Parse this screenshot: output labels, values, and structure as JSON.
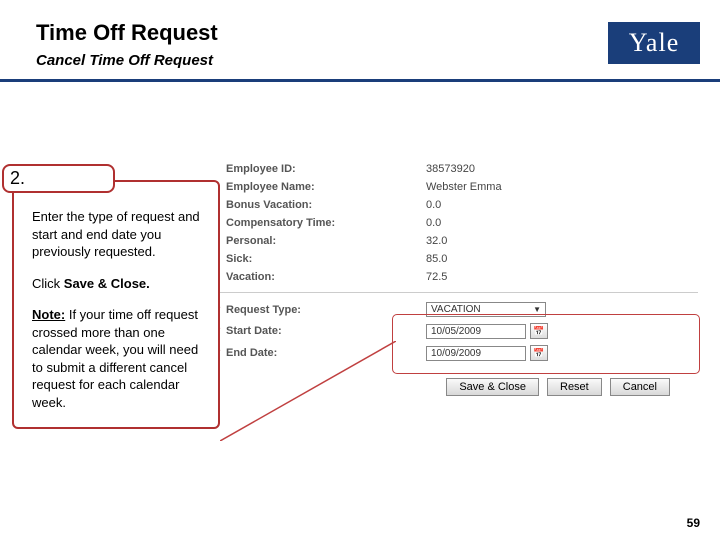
{
  "header": {
    "title": "Time Off Request",
    "subtitle": "Cancel Time Off Request",
    "logo_text": "Yale"
  },
  "step": {
    "number": "2."
  },
  "instructions": {
    "p1": "Enter the type of request and start and end date you previously requested.",
    "p2_prefix": "Click ",
    "p2_bold": "Save & Close.",
    "note_label": "Note:",
    "note_body": " If your time off request crossed more than one calendar week, you will need to submit a different cancel request for each calendar week."
  },
  "form": {
    "fields": {
      "employee_id": {
        "label": "Employee ID:",
        "value": "38573920"
      },
      "employee_name": {
        "label": "Employee Name:",
        "value": "Webster Emma"
      },
      "bonus_vacation": {
        "label": "Bonus Vacation:",
        "value": "0.0"
      },
      "compensatory_time": {
        "label": "Compensatory Time:",
        "value": "0.0"
      },
      "personal": {
        "label": "Personal:",
        "value": "32.0"
      },
      "sick": {
        "label": "Sick:",
        "value": "85.0"
      },
      "vacation": {
        "label": "Vacation:",
        "value": "72.5"
      }
    },
    "inputs": {
      "request_type": {
        "label": "Request Type:",
        "value": "VACATION"
      },
      "start_date": {
        "label": "Start Date:",
        "value": "10/05/2009"
      },
      "end_date": {
        "label": "End Date:",
        "value": "10/09/2009"
      }
    },
    "buttons": {
      "save_close": "Save & Close",
      "reset": "Reset",
      "cancel": "Cancel"
    }
  },
  "page_number": "59"
}
